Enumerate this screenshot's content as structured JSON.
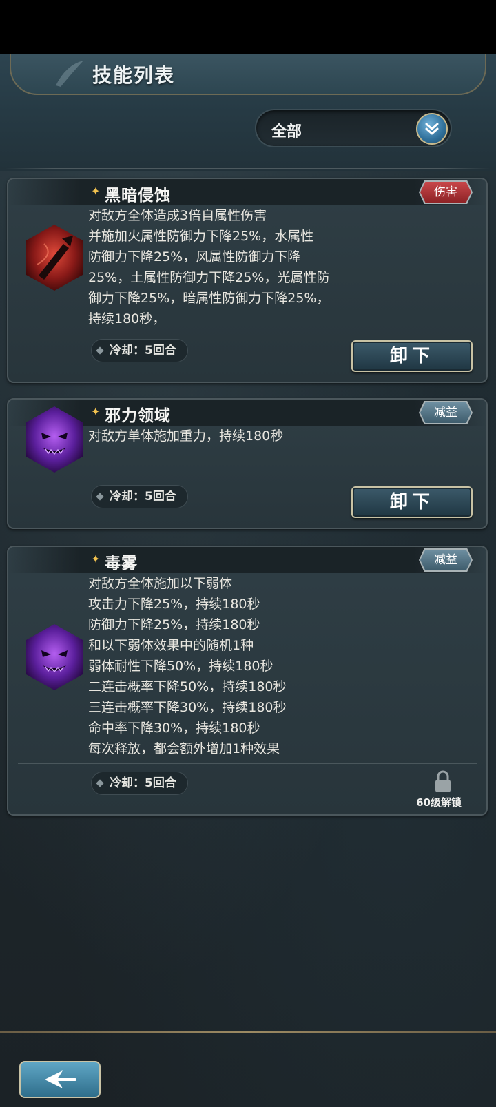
{
  "header": {
    "title": "技能列表"
  },
  "filter": {
    "selected": "全部"
  },
  "skills": [
    {
      "name": "黑暗侵蚀",
      "tag": "伤害",
      "tag_color": "red",
      "icon": "dark-slash-icon",
      "description": "对敌方全体造成3倍自属性伤害\n并施加火属性防御力下降25%，水属性\n防御力下降25%，风属性防御力下降\n25%，土属性防御力下降25%，光属性防\n御力下降25%，暗属性防御力下降25%，\n持续180秒，",
      "cooldown": "冷却：5回合",
      "action": "卸下"
    },
    {
      "name": "邪力领域",
      "tag": "减益",
      "tag_color": "blue",
      "icon": "evil-face-icon",
      "description": "对敌方单体施加重力，持续180秒",
      "cooldown": "冷却：5回合",
      "action": "卸下"
    },
    {
      "name": "毒雾",
      "tag": "减益",
      "tag_color": "blue",
      "icon": "evil-face-icon",
      "description": "对敌方全体施加以下弱体\n攻击力下降25%，持续180秒\n防御力下降25%，持续180秒\n和以下弱体效果中的随机1种\n弱体耐性下降50%，持续180秒\n二连击概率下降50%，持续180秒\n三连击概率下降30%，持续180秒\n命中率下降30%，持续180秒\n每次释放，都会额外增加1种效果",
      "cooldown": "冷却：5回合",
      "locked_label": "60级解锁"
    }
  ]
}
